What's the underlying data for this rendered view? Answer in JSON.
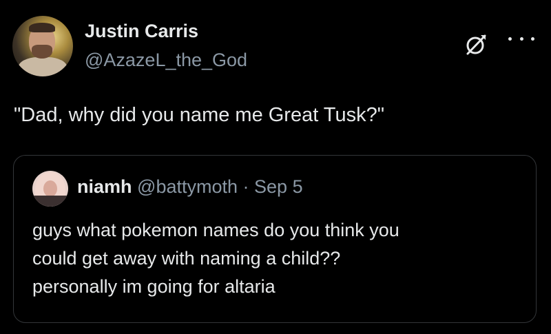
{
  "author": {
    "display_name": "Justin Carris",
    "handle": "@AzazeL_the_God",
    "avatar_icon": "profile-photo"
  },
  "actions": {
    "grok_icon": "grok-icon",
    "more_icon": "more-horizontal-icon"
  },
  "tweet": {
    "text": "\"Dad, why did you name me Great Tusk?\""
  },
  "quote": {
    "display_name": "niamh",
    "handle": "@battymoth",
    "separator": "·",
    "date": "Sep 5",
    "lines": [
      "guys what pokemon names do you think you",
      "could get away with naming a child??",
      "personally im going for altaria"
    ]
  },
  "colors": {
    "background": "#000000",
    "primary_text": "#e7e9ea",
    "secondary_text": "#8b98a5",
    "border": "#333639"
  }
}
